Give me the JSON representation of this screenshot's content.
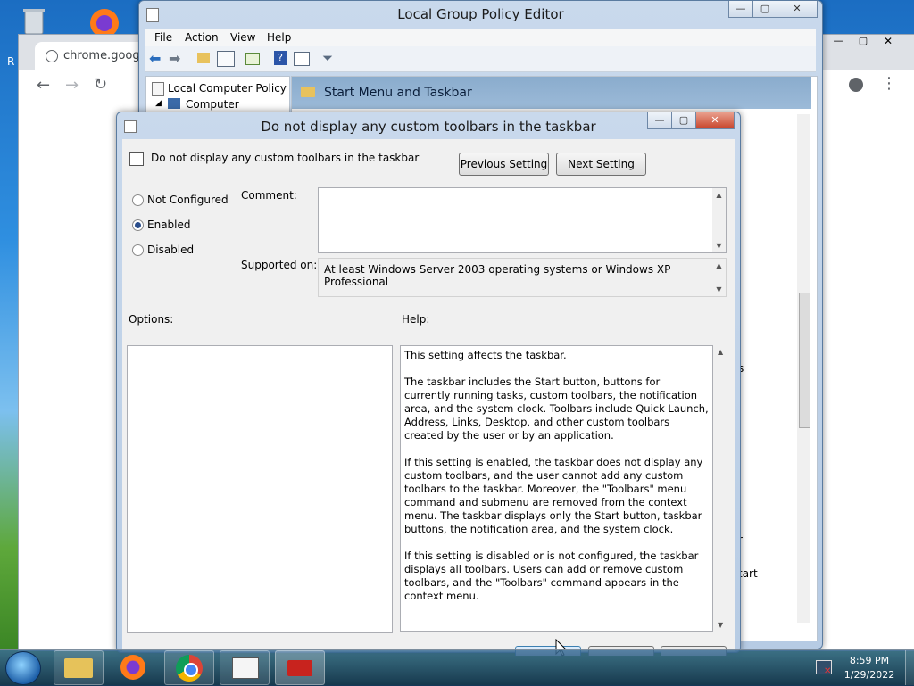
{
  "desktop": {
    "recycle_bin_icon": "recycle-bin-icon",
    "firefox_icon": "firefox-icon"
  },
  "chrome": {
    "tab_title": "chrome.google.",
    "left_edge_text": "R"
  },
  "gpe": {
    "title": "Local Group Policy Editor",
    "menu": [
      "File",
      "Action",
      "View",
      "Help"
    ],
    "tree": {
      "root": "Local Computer Policy",
      "child": "Computer Configura"
    },
    "header_title": "Start Menu and Taskbar",
    "right_fragments": [
      "s",
      "r",
      "tart"
    ]
  },
  "dialog": {
    "title": "Do not display any custom toolbars in the taskbar",
    "setting_name": "Do not display any custom toolbars in the taskbar",
    "prev_button": "Previous Setting",
    "next_button": "Next Setting",
    "radio_not_configured": "Not Configured",
    "radio_enabled": "Enabled",
    "radio_disabled": "Disabled",
    "selected": "Enabled",
    "comment_label": "Comment:",
    "comment_value": "",
    "supported_label": "Supported on:",
    "supported_value": "At least Windows Server 2003 operating systems or Windows XP Professional",
    "options_label": "Options:",
    "help_label": "Help:",
    "help_p1": "This setting affects the taskbar.",
    "help_p2": "The taskbar includes the Start button, buttons for currently running tasks, custom toolbars, the notification area, and the system clock. Toolbars include Quick Launch, Address, Links, Desktop, and other custom toolbars created by the user or by an application.",
    "help_p3": "If this setting is enabled, the taskbar does not display any custom toolbars, and the user cannot add any custom toolbars to the taskbar. Moreover, the \"Toolbars\" menu command and submenu are removed from the context menu. The taskbar displays only the Start button, taskbar buttons, the notification area, and the system clock.",
    "help_p4": "If this setting is disabled or is not configured, the taskbar displays all toolbars. Users can add or remove custom toolbars, and the \"Toolbars\" command appears in the context menu."
  },
  "taskbar": {
    "time": "8:59 PM",
    "date": "1/29/2022"
  }
}
